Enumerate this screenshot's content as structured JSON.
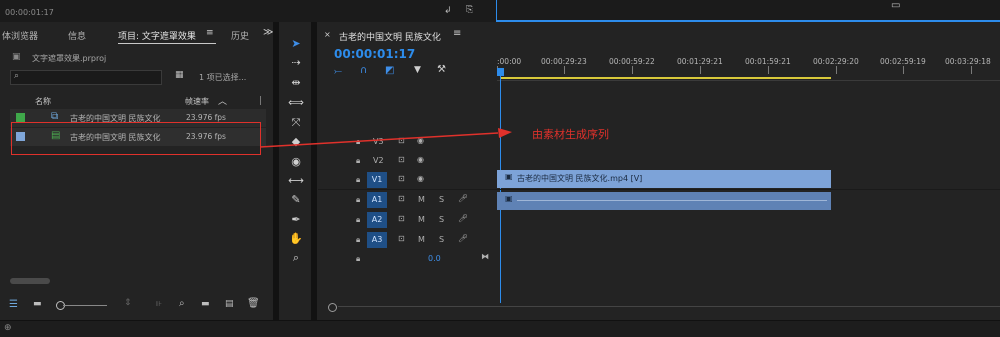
{
  "top": {
    "timecode": "00:00:01:17"
  },
  "project_panel": {
    "tabs": [
      "体浏览器",
      "信息",
      "项目: 文字遮罩效果",
      "历史"
    ],
    "active_tab_index": 2,
    "more_glyph": "≫",
    "file_name": "文字遮罩效果.prproj",
    "search_placeholder": "",
    "selection_info": "1 项已选择...",
    "columns": {
      "name": "名称",
      "framerate": "帧速率"
    },
    "items": [
      {
        "name": "古老的中国文明 民族文化",
        "fps": "23.976 fps",
        "swatch": "#3fa84a",
        "icon": "sequence-icon"
      },
      {
        "name": "古老的中国文明 民族文化",
        "fps": "23.976 fps",
        "swatch": "#7fa6d9",
        "icon": "video-clip-icon"
      }
    ]
  },
  "timeline": {
    "sequence_name": "古老的中国文明 民族文化",
    "timecode": "00:00:01:17",
    "ruler_labels": [
      ":00:00",
      "00:00:29:23",
      "00:00:59:22",
      "00:01:29:21",
      "00:01:59:21",
      "00:02:29:20",
      "00:02:59:19",
      "00:03:29:18"
    ],
    "tracks": [
      {
        "name": "V3",
        "target": "",
        "kind": "video"
      },
      {
        "name": "V2",
        "target": "",
        "kind": "video"
      },
      {
        "name": "V1",
        "target": "V1",
        "kind": "video"
      },
      {
        "name": "A1",
        "target": "A1",
        "kind": "audio",
        "m": "M",
        "s": "S"
      },
      {
        "name": "A2",
        "target": "A2",
        "kind": "audio",
        "m": "M",
        "s": "S"
      },
      {
        "name": "A3",
        "target": "A3",
        "kind": "audio",
        "m": "M",
        "s": "S"
      }
    ],
    "master_volume": "0.0",
    "video_clip_label": "古老的中国文明 民族文化.mp4 [V]"
  },
  "annotation": {
    "text": "由素材生成序列",
    "color": "#e0312b"
  },
  "colors": {
    "accent": "#2d8ceb",
    "clip": "#7da3d8",
    "work_area": "#d8c93a"
  }
}
